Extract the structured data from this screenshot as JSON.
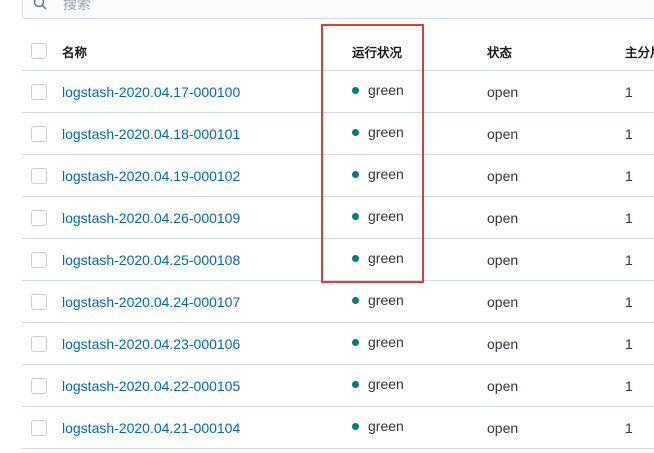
{
  "search": {
    "placeholder": "搜索"
  },
  "table": {
    "headers": {
      "name": "名称",
      "health": "运行状况",
      "status": "状态",
      "primary_shards": "主分片"
    },
    "health_color": "#017d73",
    "highlight_color": "#e0393e",
    "rows": [
      {
        "name": "logstash-2020.04.17-000100",
        "health": "green",
        "status": "open",
        "primary_shards": "1"
      },
      {
        "name": "logstash-2020.04.18-000101",
        "health": "green",
        "status": "open",
        "primary_shards": "1"
      },
      {
        "name": "logstash-2020.04.19-000102",
        "health": "green",
        "status": "open",
        "primary_shards": "1"
      },
      {
        "name": "logstash-2020.04.26-000109",
        "health": "green",
        "status": "open",
        "primary_shards": "1"
      },
      {
        "name": "logstash-2020.04.25-000108",
        "health": "green",
        "status": "open",
        "primary_shards": "1"
      },
      {
        "name": "logstash-2020.04.24-000107",
        "health": "green",
        "status": "open",
        "primary_shards": "1"
      },
      {
        "name": "logstash-2020.04.23-000106",
        "health": "green",
        "status": "open",
        "primary_shards": "1"
      },
      {
        "name": "logstash-2020.04.22-000105",
        "health": "green",
        "status": "open",
        "primary_shards": "1"
      },
      {
        "name": "logstash-2020.04.21-000104",
        "health": "green",
        "status": "open",
        "primary_shards": "1"
      }
    ]
  }
}
